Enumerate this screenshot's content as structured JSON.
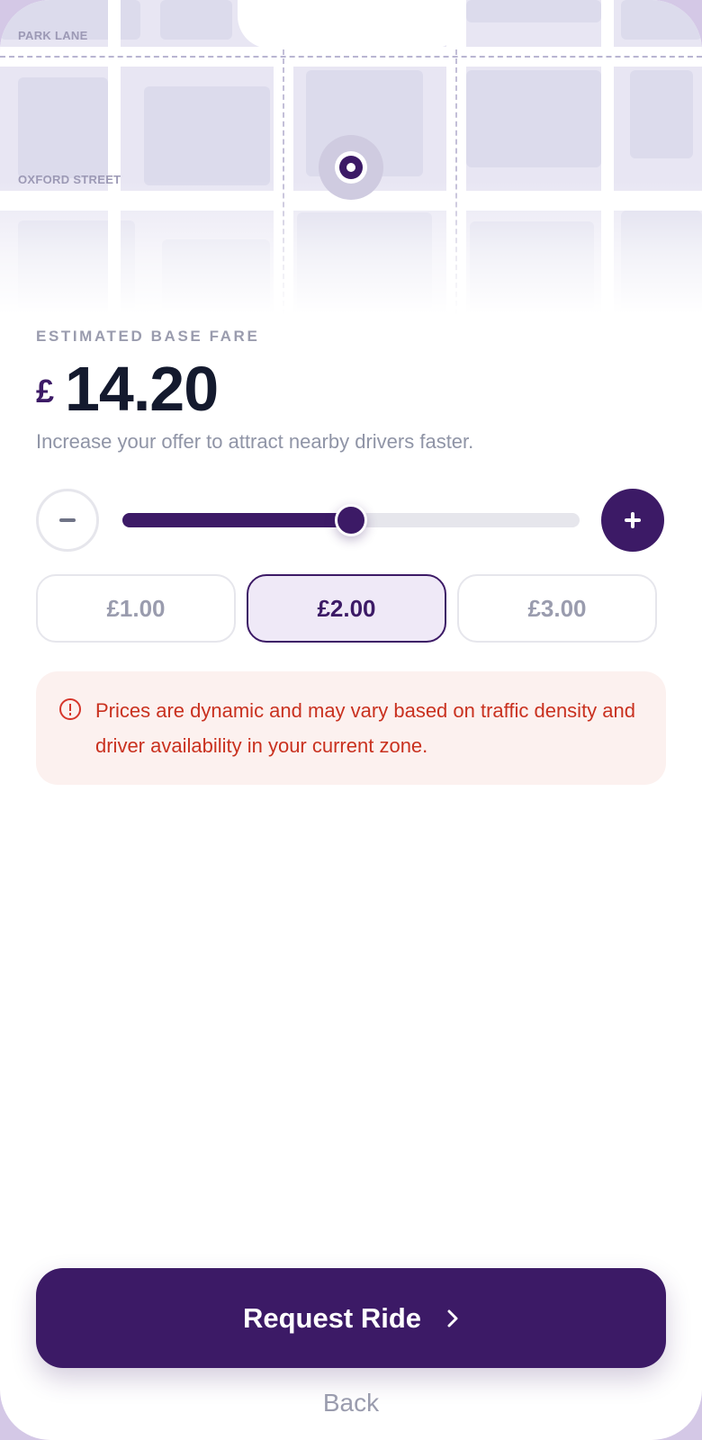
{
  "map": {
    "streets": [
      "PARK LANE",
      "OXFORD STREET"
    ],
    "pin_icon": "location-pin-icon"
  },
  "fare": {
    "label": "ESTIMATED BASE FARE",
    "currency": "£",
    "amount": "14.20",
    "hint": "Increase your offer to attract nearby drivers faster."
  },
  "slider": {
    "value_fraction": 0.5,
    "decrease_icon": "minus-icon",
    "increase_icon": "plus-icon"
  },
  "increments": [
    {
      "label": "£1.00",
      "selected": false
    },
    {
      "label": "£2.00",
      "selected": true
    },
    {
      "label": "£3.00",
      "selected": false
    }
  ],
  "notice": {
    "icon": "alert-circle-icon",
    "text": "Prices are dynamic and may vary based on traffic density and driver availability in your current zone."
  },
  "actions": {
    "request_label": "Request Ride",
    "request_icon": "chevron-right-icon",
    "back_label": "Back"
  },
  "colors": {
    "brand": "#3c1a66",
    "warning": "#c9311f",
    "warning_bg": "#fcf1ef"
  }
}
